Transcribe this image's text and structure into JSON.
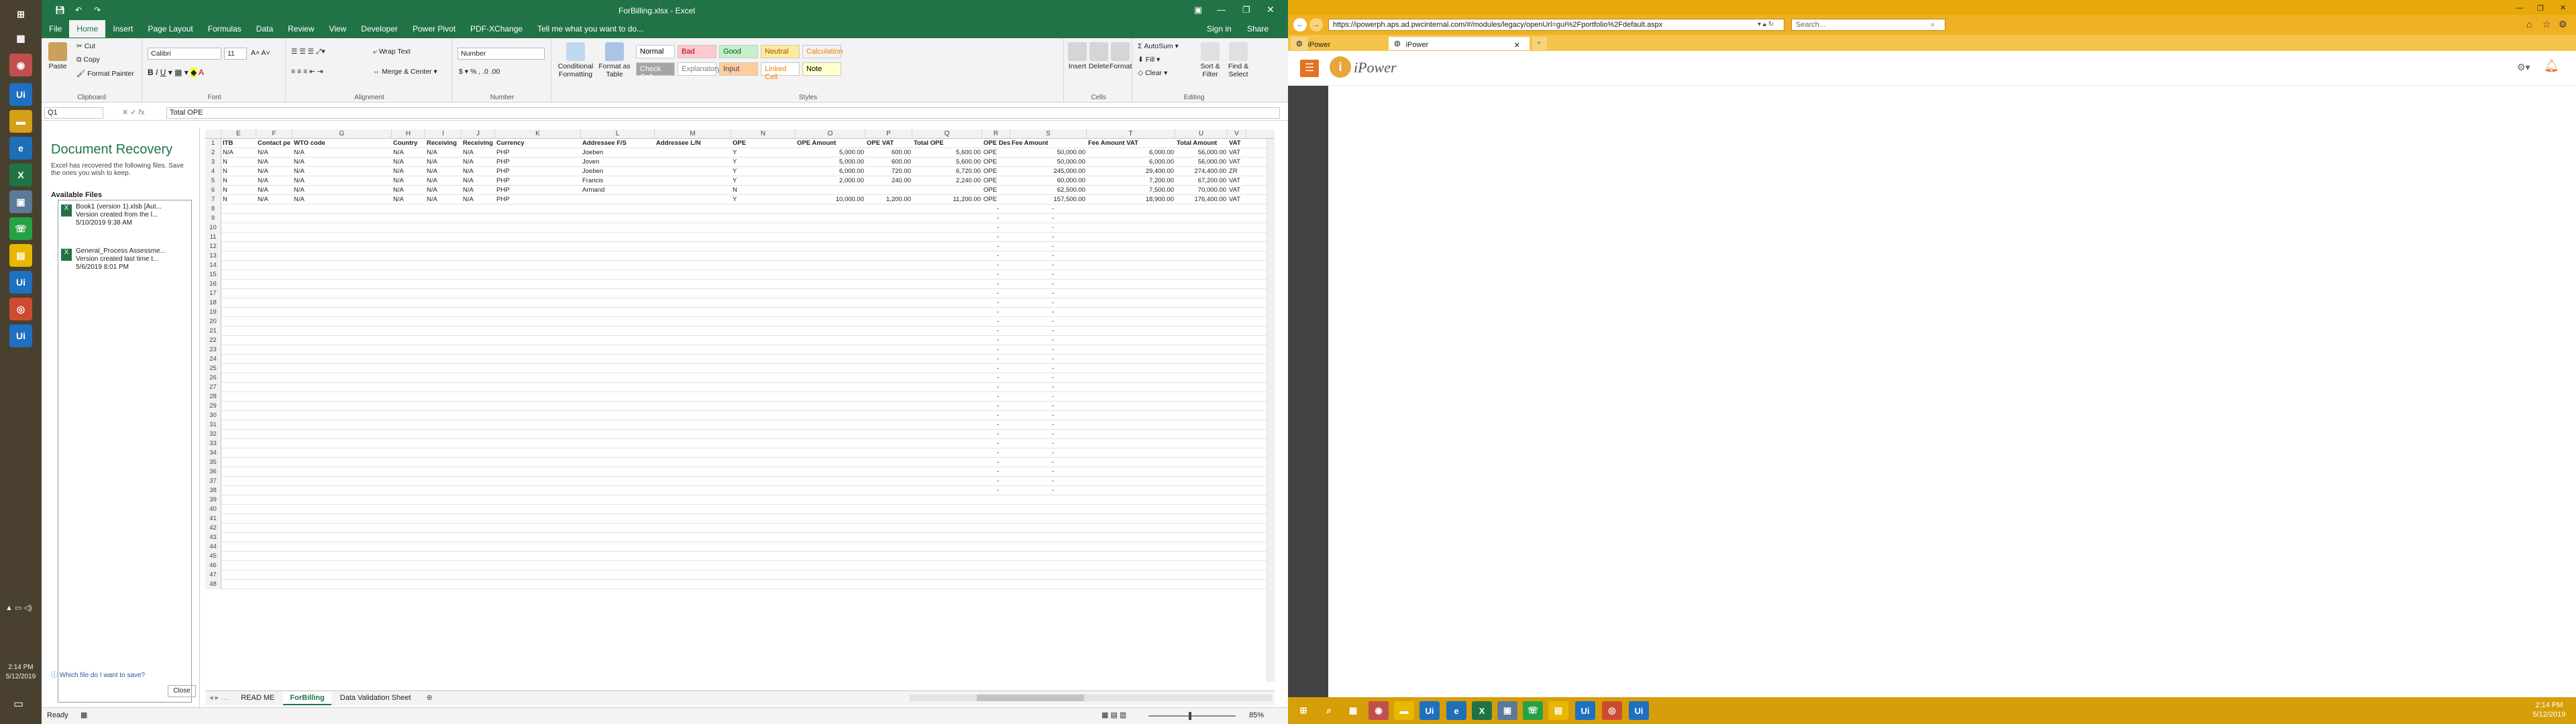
{
  "excel": {
    "title": "ForBilling.xlsx - Excel",
    "sign_in": "Sign in",
    "share": "Share",
    "ribbon_tabs": [
      "File",
      "Home",
      "Insert",
      "Page Layout",
      "Formulas",
      "Data",
      "Review",
      "View",
      "Developer",
      "Power Pivot",
      "PDF-XChange"
    ],
    "tell_me": "Tell me what you want to do...",
    "clipboard": {
      "group": "Clipboard",
      "paste": "Paste",
      "cut": "Cut",
      "copy": "Copy",
      "format_painter": "Format Painter"
    },
    "font": {
      "group": "Font",
      "name": "Calibri",
      "size": "11"
    },
    "alignment": {
      "group": "Alignment",
      "wrap": "Wrap Text",
      "merge": "Merge & Center"
    },
    "number": {
      "group": "Number",
      "format": "Number"
    },
    "styles": {
      "group": "Styles",
      "conditional": "Conditional Formatting",
      "format_table": "Format as Table",
      "items": [
        {
          "label": "Normal",
          "bg": "#ffffff",
          "fg": "#000000"
        },
        {
          "label": "Bad",
          "bg": "#ffc7ce",
          "fg": "#9c0006"
        },
        {
          "label": "Good",
          "bg": "#c6efce",
          "fg": "#006100"
        },
        {
          "label": "Neutral",
          "bg": "#ffeb9c",
          "fg": "#9c5700"
        },
        {
          "label": "Calculation",
          "bg": "#f2f2f2",
          "fg": "#fa7d00"
        },
        {
          "label": "Check Cell",
          "bg": "#a5a5a5",
          "fg": "#ffffff"
        },
        {
          "label": "Explanatory...",
          "bg": "#ffffff",
          "fg": "#7f7f7f"
        },
        {
          "label": "Input",
          "bg": "#ffcc99",
          "fg": "#3f3f76"
        },
        {
          "label": "Linked Cell",
          "bg": "#ffffff",
          "fg": "#fa7d00"
        },
        {
          "label": "Note",
          "bg": "#ffffcc",
          "fg": "#000000"
        }
      ]
    },
    "cells": {
      "group": "Cells",
      "insert": "Insert",
      "delete": "Delete",
      "format": "Format"
    },
    "editing": {
      "group": "Editing",
      "autosum": "AutoSum",
      "fill": "Fill",
      "clear": "Clear",
      "sort": "Sort & Filter",
      "find": "Find & Select"
    },
    "name_box": "Q1",
    "formula": "Total OPE",
    "recovery": {
      "title": "Document Recovery",
      "desc": "Excel has recovered the following files. Save the ones you wish to keep.",
      "available": "Available Files",
      "files": [
        {
          "name": "Book1 (version 1).xlsb  [Aut...",
          "line2": "Version created from the l...",
          "date": "5/10/2019 9:38 AM"
        },
        {
          "name": "General_Process Assessme...",
          "line2": "Version created last time t...",
          "date": "5/6/2019 8:01 PM"
        }
      ],
      "which": "Which file do I want to save?",
      "close": "Close"
    },
    "columns": [
      "E",
      "F",
      "G",
      "H",
      "I",
      "J",
      "K",
      "L",
      "M",
      "N",
      "O",
      "P",
      "Q",
      "R",
      "S",
      "T",
      "U",
      "V"
    ],
    "header_row": [
      "ITB",
      "Contact pe",
      "WTO code",
      "Country",
      "Receiving",
      "Receiving",
      "Currency",
      "Addressee F/S",
      "Addressee L/N",
      "OPE",
      "OPE Amount",
      "OPE VAT",
      "Total OPE",
      "OPE Descrip",
      "Fee Amount",
      "Fee Amount VAT",
      "Total Amount",
      "VAT"
    ],
    "rows": [
      [
        "N/A",
        "N/A",
        "N/A",
        "N/A",
        "N/A",
        "N/A",
        "PHP",
        "Joeben",
        "",
        "Y",
        "5,000.00",
        "600.00",
        "5,600.00",
        "OPE",
        "50,000.00",
        "6,000.00",
        "56,000.00",
        "VAT"
      ],
      [
        "N",
        "N/A",
        "N/A",
        "N/A",
        "N/A",
        "N/A",
        "PHP",
        "Joven",
        "",
        "Y",
        "5,000.00",
        "600.00",
        "5,600.00",
        "OPE",
        "50,000.00",
        "6,000.00",
        "56,000.00",
        "VAT"
      ],
      [
        "N",
        "N/A",
        "N/A",
        "N/A",
        "N/A",
        "N/A",
        "PHP",
        "Joeben",
        "",
        "Y",
        "6,000.00",
        "720.00",
        "6,720.00",
        "OPE",
        "245,000.00",
        "29,400.00",
        "274,400.00",
        "ZR"
      ],
      [
        "N",
        "N/A",
        "N/A",
        "N/A",
        "N/A",
        "N/A",
        "PHP",
        "Francis",
        "",
        "Y",
        "2,000.00",
        "240.00",
        "2,240.00",
        "OPE",
        "60,000.00",
        "7,200.00",
        "67,200.00",
        "VAT"
      ],
      [
        "N",
        "N/A",
        "N/A",
        "N/A",
        "N/A",
        "N/A",
        "PHP",
        "Armand",
        "",
        "N",
        "",
        "",
        "",
        "OPE",
        "62,500.00",
        "7,500.00",
        "70,000.00",
        "VAT"
      ],
      [
        "N",
        "N/A",
        "N/A",
        "N/A",
        "N/A",
        "N/A",
        "PHP",
        "",
        "",
        "Y",
        "10,000.00",
        "1,200.00",
        "11,200.00",
        "OPE",
        "157,500.00",
        "18,900.00",
        "176,400.00",
        "VAT"
      ]
    ],
    "dash": "-",
    "sheet_tabs": [
      "READ ME",
      "ForBilling",
      "Data Validation Sheet"
    ],
    "status_ready": "Ready",
    "zoom": "85%"
  },
  "left_taskbar": {
    "time": "2:14 PM",
    "date": "5/12/2019"
  },
  "browser": {
    "url": "https://ipowerph.aps.ad.pwcinternal.com/#/modules/legacy/openUrl=gui%2Fportfolio%2Fdefault.aspx",
    "search_placeholder": "Search...",
    "tabs": [
      "iPower",
      "iPower"
    ],
    "app_name": "iPower"
  },
  "right_taskbar": {
    "time": "2:14 PM",
    "date": "5/12/2019"
  },
  "colors": {
    "excel_green": "#217346",
    "taskbar_gold": "#d69e08"
  }
}
